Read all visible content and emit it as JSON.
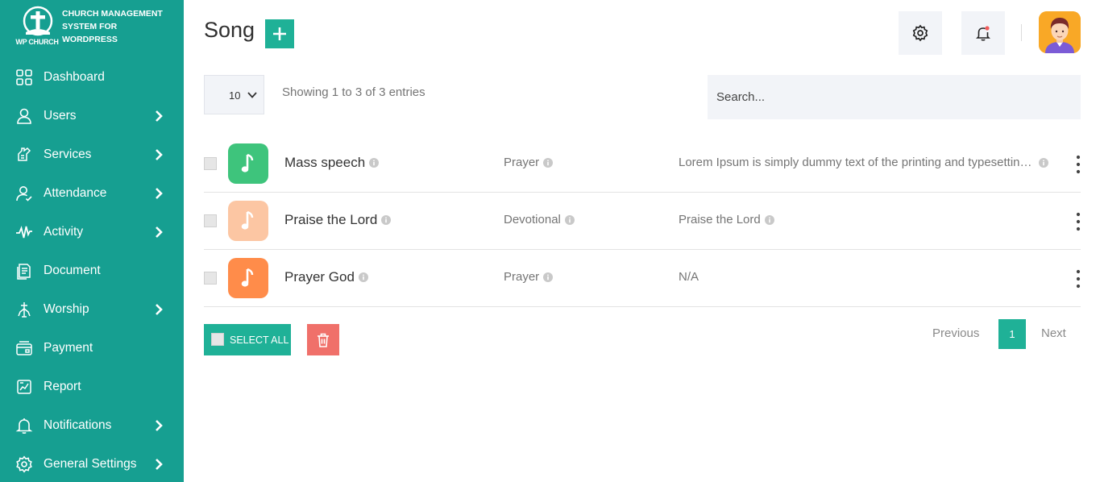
{
  "brand": {
    "logo_text": "WP CHURCH",
    "name_line1": "CHURCH MANAGEMENT",
    "name_line2": "SYSTEM FOR",
    "name_line3": "WORDPRESS"
  },
  "sidebar": {
    "items": [
      {
        "label": "Dashboard",
        "icon": "dashboard-icon",
        "has_submenu": false
      },
      {
        "label": "Users",
        "icon": "user-icon",
        "has_submenu": true
      },
      {
        "label": "Services",
        "icon": "services-icon",
        "has_submenu": true
      },
      {
        "label": "Attendance",
        "icon": "attendance-icon",
        "has_submenu": true
      },
      {
        "label": "Activity",
        "icon": "activity-icon",
        "has_submenu": true
      },
      {
        "label": "Document",
        "icon": "document-icon",
        "has_submenu": false
      },
      {
        "label": "Worship",
        "icon": "worship-icon",
        "has_submenu": true
      },
      {
        "label": "Payment",
        "icon": "payment-icon",
        "has_submenu": false
      },
      {
        "label": "Report",
        "icon": "report-icon",
        "has_submenu": false
      },
      {
        "label": "Notifications",
        "icon": "bell-icon",
        "has_submenu": true
      },
      {
        "label": "General Settings",
        "icon": "gear-icon",
        "has_submenu": true
      }
    ]
  },
  "header": {
    "title": "Song"
  },
  "controls": {
    "page_size": "10",
    "entries_info": "Showing 1 to 3 of 3 entries",
    "search_placeholder": "Search..."
  },
  "songs": [
    {
      "name": "Mass speech",
      "category": "Prayer",
      "description": "Lorem Ipsum is simply dummy text of the printing and typesetting industry.",
      "thumb_color": "#3ec47c"
    },
    {
      "name": "Praise the Lord",
      "category": "Devotional",
      "description": "Praise the Lord",
      "thumb_color": "#fcc6a3"
    },
    {
      "name": "Prayer God",
      "category": "Prayer",
      "description": "N/A",
      "thumb_color": "#ff8c4a"
    }
  ],
  "actions": {
    "select_all_label": "SELECT ALL"
  },
  "pagination": {
    "previous": "Previous",
    "current": "1",
    "next": "Next"
  },
  "colors": {
    "sidebar_bg": "#169f91",
    "accent": "#1fb197",
    "danger": "#f0706a",
    "notification_dot": "#f15b5b"
  }
}
